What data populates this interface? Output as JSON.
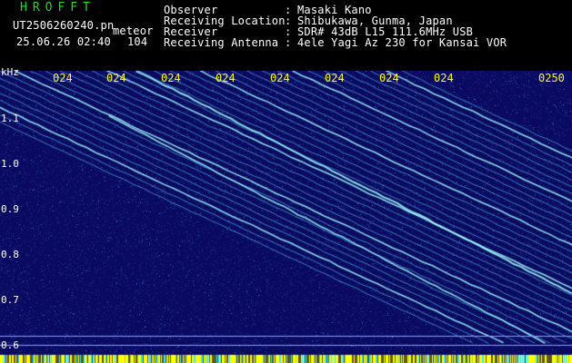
{
  "header": {
    "app_name": "HROFFT",
    "file_name": "UT2506260240.pn",
    "file_tag": "meteor",
    "datetime": "25.06.26 02:40",
    "count": "104",
    "info": [
      {
        "label": "Observer",
        "sep": ":",
        "value": "Masaki Kano"
      },
      {
        "label": "Receiving Location",
        "sep": ":",
        "value": "Shibukawa, Gunma, Japan"
      },
      {
        "label": "Receiver",
        "sep": ":",
        "value": "SDR# 43dB L15 111.6MHz USB"
      },
      {
        "label": "Receiving Antenna",
        "sep": ":",
        "value": "4ele Yagi Az 230 for Kansai VOR"
      }
    ]
  },
  "spectrogram": {
    "unit": "kHz",
    "y_ticks": [
      "1.1",
      "1.0",
      "0.9",
      "0.8",
      "0.7",
      "0.6"
    ],
    "x_ticks": [
      "024",
      "024",
      "024",
      "024",
      "024",
      "024",
      "024",
      "024",
      "0250"
    ],
    "colors": {
      "background": "#0a0a60",
      "noise_low": "#1a2a90",
      "noise_high": "#3a60e0",
      "trace": "#60e0ff",
      "trace_bright": "#a0ffff",
      "bottom_band": "#ffff00",
      "tick_label": "#ffff00",
      "axis_label": "#ffffff"
    }
  }
}
